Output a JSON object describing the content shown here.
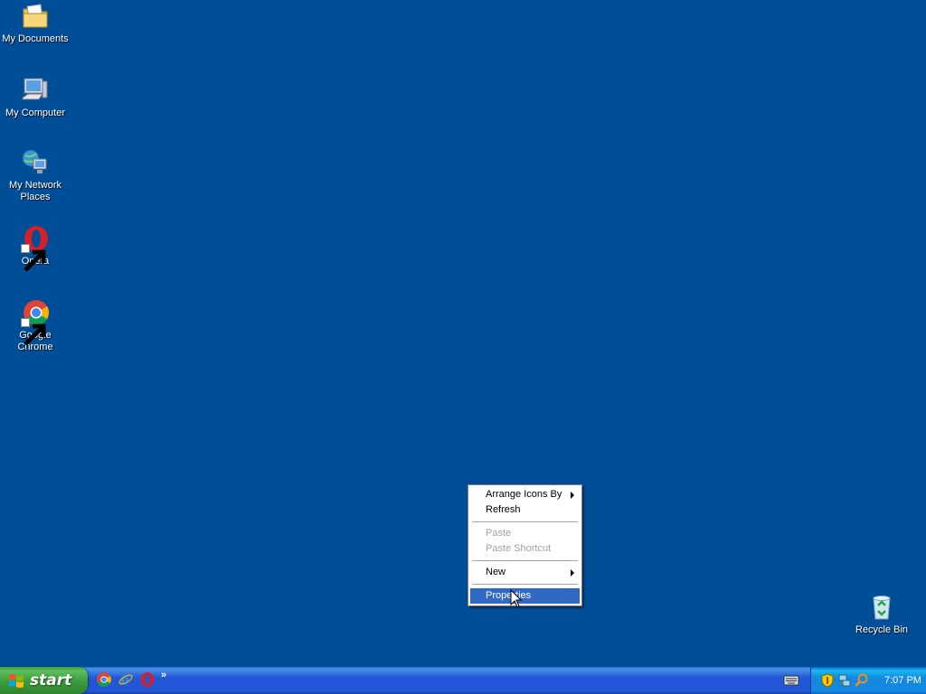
{
  "desktop": {
    "background_color": "#004e98",
    "icons": [
      {
        "label": "My Documents",
        "icon": "folder-documents-icon"
      },
      {
        "label": "My Computer",
        "icon": "computer-icon"
      },
      {
        "label": "My Network Places",
        "icon": "network-places-icon"
      },
      {
        "label": "Opera",
        "icon": "opera-icon"
      },
      {
        "label": "Google Chrome",
        "icon": "chrome-icon"
      },
      {
        "label": "Recycle Bin",
        "icon": "recycle-bin-icon"
      }
    ]
  },
  "context_menu": {
    "items": [
      {
        "label": "Arrange Icons By",
        "submenu": true,
        "enabled": true
      },
      {
        "label": "Refresh",
        "enabled": true
      },
      {
        "label": "Paste",
        "enabled": false
      },
      {
        "label": "Paste Shortcut",
        "enabled": false
      },
      {
        "label": "New",
        "submenu": true,
        "enabled": true
      },
      {
        "label": "Properties",
        "enabled": true,
        "selected": true
      }
    ],
    "highlight_color": "#316ac5"
  },
  "taskbar": {
    "start_label": "start",
    "quick_launch": [
      "chrome-icon",
      "internet-explorer-icon",
      "opera-icon"
    ],
    "chevron": "»",
    "tray_icons": [
      "security-shield-icon",
      "network-icon",
      "search-icon"
    ],
    "clock": "7:07 PM"
  }
}
